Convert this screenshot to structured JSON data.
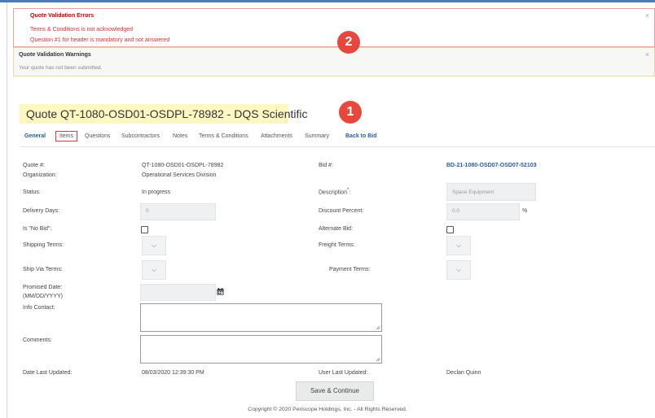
{
  "errors": {
    "title": "Quote Validation Errors",
    "items": [
      "Terms & Conditions is not acknowledged",
      "Question #1 for header is mandatory and not answered"
    ],
    "close": "×"
  },
  "warnings": {
    "title": "Quote Validation Warnings",
    "items": [
      "Your quote has not been submitted."
    ],
    "close": "×"
  },
  "badges": [
    "2",
    "1"
  ],
  "title": "Quote QT-1080-OSD01-OSDPL-78982 - DQS Scientific",
  "tabs": [
    "General",
    "Items",
    "Questions",
    "Subcontractors",
    "Notes",
    "Terms & Conditions",
    "Attachments",
    "Summary",
    "Back to Bid"
  ],
  "form": {
    "quote_label": "Quote #:",
    "quote_value": "QT-1080-OSD01-OSDPL-78982",
    "org_label": "Organization:",
    "org_value": "Operational Services Division",
    "bid_label": "Bid #:",
    "bid_value": "BD-21-1080-OSD07-OSD07-52103",
    "status_label": "Status:",
    "status_value": "In progress",
    "desc_label": "Description",
    "desc_req": "*",
    "desc_colon": ":",
    "desc_value": "Space Equipment",
    "delivery_label": "Delivery Days:",
    "delivery_value": "0",
    "discount_label": "Discount Percent:",
    "discount_value": "0.0",
    "discount_unit": "%",
    "nobid_label": "Is \"No Bid\":",
    "alternate_label": "Alternate Bid:",
    "shipping_label": "Shipping Terms:",
    "freight_label": "Freight Terms:",
    "shipvia_label": "Ship Via Terms:",
    "payment_label": "Payment Terms:",
    "promised_label_1": "Promised Date:",
    "promised_label_2": "(MM/DD/YYYY)",
    "info_label": "Info Contact:",
    "comments_label": "Comments:",
    "updated_label": "Date Last Updated:",
    "updated_value": "08/03/2020 12:39:30 PM",
    "user_label": "User Last Updated:",
    "user_value": "Declan Quinn",
    "chevron": "⌵"
  },
  "save_label": "Save & Continue",
  "copyright": "Copyright © 2020 Periscope Holdings, Inc. - All Rights Reserved.",
  "colors": {
    "error": "#cc0000",
    "link": "#2a5ea8",
    "badge": "#e8473e",
    "highlight": "#fdf7c2"
  }
}
